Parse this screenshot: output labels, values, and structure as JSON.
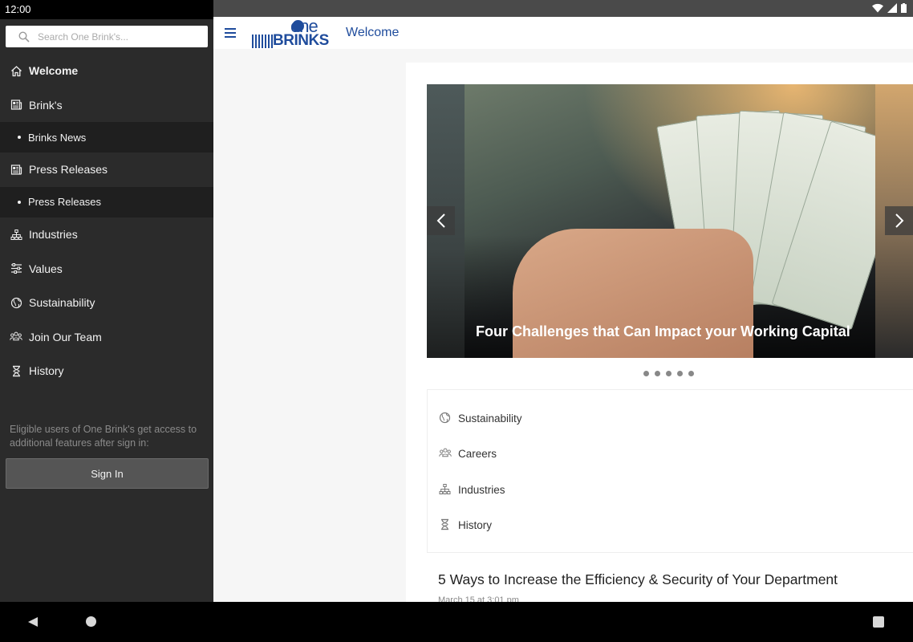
{
  "status_bar": {
    "time": "12:00"
  },
  "search": {
    "placeholder": "Search One Brink's..."
  },
  "sidebar": {
    "items": [
      {
        "label": "Welcome",
        "icon": "home-icon"
      },
      {
        "label": "Brink's",
        "icon": "newspaper-icon"
      },
      {
        "label": "Brinks News",
        "sub": true
      },
      {
        "label": "Press Releases",
        "icon": "newspaper-icon"
      },
      {
        "label": "Press Releases",
        "sub": true
      },
      {
        "label": "Industries",
        "icon": "org-chart-icon"
      },
      {
        "label": "Values",
        "icon": "sliders-icon"
      },
      {
        "label": "Sustainability",
        "icon": "globe-icon"
      },
      {
        "label": "Join Our Team",
        "icon": "team-icon"
      },
      {
        "label": "History",
        "icon": "hourglass-icon"
      }
    ],
    "signin_note": "Eligible users of One Brink's get access to additional features after sign in:",
    "signin_label": "Sign In"
  },
  "header": {
    "logo_one": "one",
    "logo_brinks": "BRINKS",
    "title": "Welcome"
  },
  "carousel": {
    "caption": "Four Challenges that Can Impact your Working Capital",
    "dots": 5
  },
  "quick_links": [
    {
      "label": "Sustainability",
      "icon": "globe-icon"
    },
    {
      "label": "Careers",
      "icon": "team-icon"
    },
    {
      "label": "Industries",
      "icon": "org-chart-icon"
    },
    {
      "label": "History",
      "icon": "hourglass-icon"
    }
  ],
  "article": {
    "title": "5 Ways to Increase the Efficiency & Security of Your Department",
    "date": "March 15 at 3:01 pm"
  },
  "colors": {
    "brand": "#1f4c9c",
    "sidebar_bg": "#2b2b2b"
  }
}
